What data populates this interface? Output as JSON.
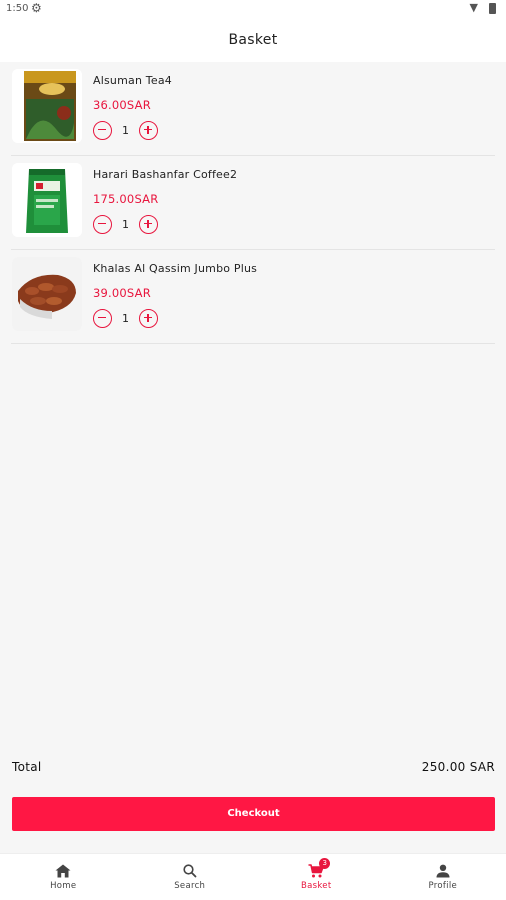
{
  "status_bar": {
    "time": "1:50"
  },
  "app_bar": {
    "title": "Basket"
  },
  "items": [
    {
      "name": "Alsuman Tea4",
      "price": "36.00SAR",
      "qty": "1",
      "image": "tea-package"
    },
    {
      "name": "Harari Bashanfar Coffee2",
      "price": "175.00SAR",
      "qty": "1",
      "image": "coffee-bag"
    },
    {
      "name": "Khalas Al Qassim Jumbo Plus",
      "price": "39.00SAR",
      "qty": "1",
      "image": "dates-pack"
    }
  ],
  "summary": {
    "total_label": "Total",
    "total_value": "250.00 SAR"
  },
  "checkout": {
    "label": "Checkout"
  },
  "nav": {
    "home": "Home",
    "search": "Search",
    "basket": "Basket",
    "basket_badge": "3",
    "profile": "Profile"
  },
  "colors": {
    "accent": "#ff1744",
    "price": "#e8163e",
    "background": "#f6f6f6"
  }
}
